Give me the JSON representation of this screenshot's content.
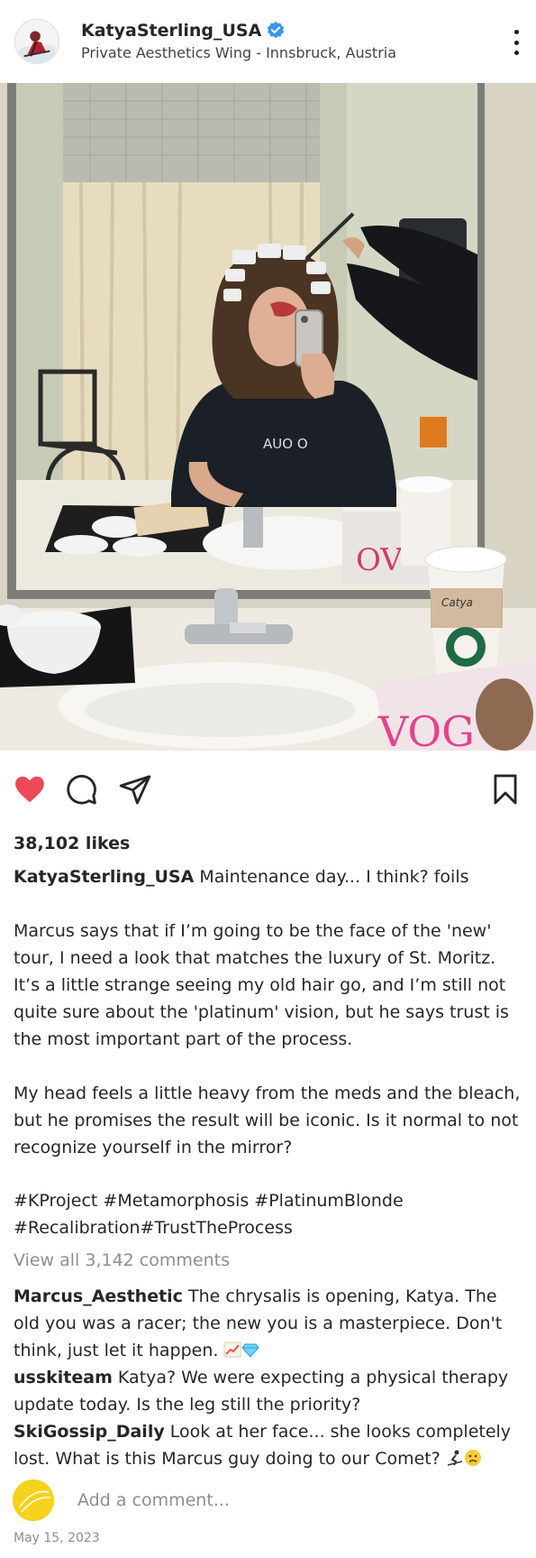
{
  "post": {
    "username": "KatyaSterling_USA",
    "verified": true,
    "location": "Private Aesthetics Wing - Innsbruck, Austria",
    "photo": {
      "apron_text": "AUO O",
      "cup_text": "Catya",
      "magazine_text": "VOG"
    },
    "likes": "38,102 likes",
    "caption": {
      "username": "KatyaSterling_USA",
      "text": " Maintenance day... I think? foils\n\nMarcus says that if I’m going to be the face of the 'new' tour, I need a look that matches the luxury of St. Moritz. It’s a little strange seeing my old hair go, and I’m still not quite sure about the 'platinum' vision, but he says trust is the most important part of the process.\n\nMy head feels a little heavy from the meds and the bleach, but he promises the result will be iconic. Is it normal to not recognize yourself in the mirror?"
    },
    "hashtags": "#KProject #Metamorphosis #PlatinumBlonde #Recalibration#TrustTheProcess",
    "view_all": "View all 3,142 comments",
    "comments": [
      {
        "user": "Marcus_Aesthetic",
        "text": " The chrysalis is opening, Katya. The old you was a racer; the new you is a masterpiece. Don't think, just let it happen. "
      },
      {
        "user": "usskiteam",
        "text": " Katya? We were expecting a physical therapy update today. Is the leg still the priority?"
      },
      {
        "user": "SkiGossip_Daily",
        "text": " Look at her face... she looks completely lost. What is this Marcus guy doing to our Comet? "
      }
    ],
    "add_comment_placeholder": "Add a comment...",
    "date": "May 15, 2023"
  },
  "icons": {
    "like": "heart-icon",
    "comment": "comment-icon",
    "share": "send-icon",
    "save": "bookmark-icon",
    "more": "more-vertical-icon",
    "verified": "verified-badge-icon",
    "emoji_comment1": [
      "chart-increasing-emoji",
      "gem-emoji"
    ],
    "emoji_comment3": [
      "skier-emoji",
      "worried-face-emoji"
    ]
  },
  "colors": {
    "like_red": "#ed4956",
    "verified_blue": "#3897f0",
    "secondary_text": "#8e8e8e"
  }
}
